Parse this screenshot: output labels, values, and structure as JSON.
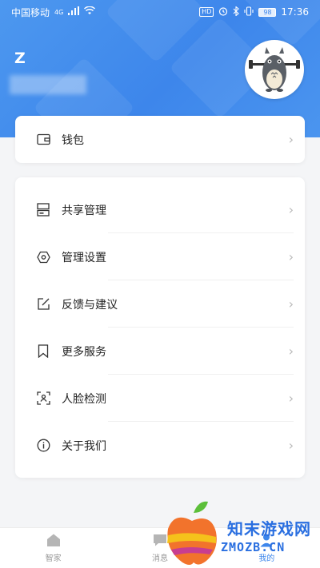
{
  "status_bar": {
    "carrier": "中国移动",
    "network": "4G",
    "hd": "HD",
    "battery": "98",
    "time": "17:36"
  },
  "profile": {
    "name": "Z"
  },
  "wallet_card": {
    "items": [
      {
        "icon": "wallet-icon",
        "label": "钱包"
      }
    ]
  },
  "menu_card": {
    "items": [
      {
        "icon": "share-manage-icon",
        "label": "共享管理"
      },
      {
        "icon": "settings-icon",
        "label": "管理设置"
      },
      {
        "icon": "feedback-edit-icon",
        "label": "反馈与建议"
      },
      {
        "icon": "bookmark-icon",
        "label": "更多服务"
      },
      {
        "icon": "face-scan-icon",
        "label": "人脸检测"
      },
      {
        "icon": "info-icon",
        "label": "关于我们"
      }
    ]
  },
  "tabbar": {
    "tabs": [
      {
        "icon": "home-icon",
        "label": "智家"
      },
      {
        "icon": "message-icon",
        "label": "消息"
      },
      {
        "icon": "profile-icon",
        "label": "我的"
      }
    ]
  },
  "watermark": {
    "line1": "知末游戏网",
    "line2": "ZMOZB.CN"
  },
  "colors": {
    "accent": "#3d86eb",
    "chevron": "#b8b8b8",
    "background": "#f4f5f7"
  }
}
